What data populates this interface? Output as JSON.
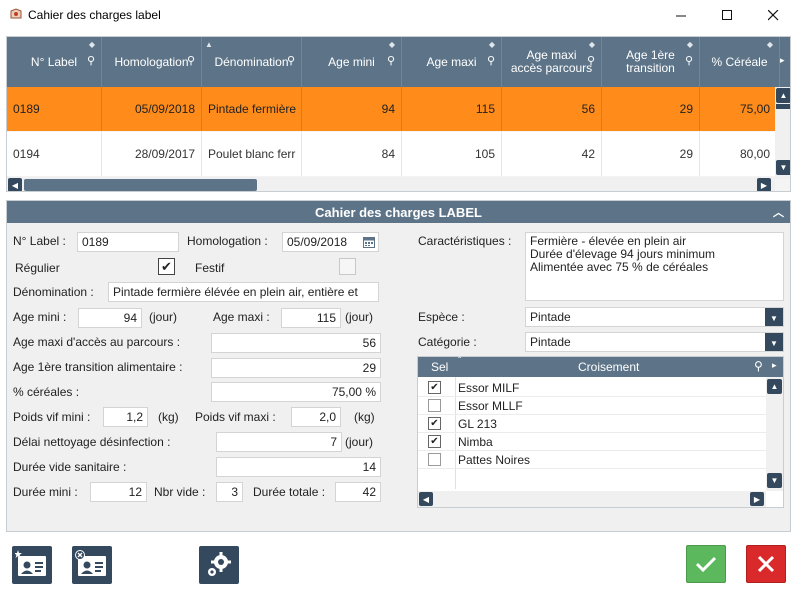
{
  "window": {
    "title": "Cahier des charges label"
  },
  "grid": {
    "columns": [
      "N° Label",
      "Homologation",
      "Dénomination",
      "Age mini",
      "Age maxi",
      "Age maxi\naccès parcours",
      "Age 1ère\ntransition",
      "% Céréale"
    ],
    "rows": [
      {
        "label": "0189",
        "homologation": "05/09/2018",
        "denomination": "Pintade fermière",
        "age_mini": "94",
        "age_maxi": "115",
        "age_parcours": "56",
        "age_transition": "29",
        "cereales": "75,00"
      },
      {
        "label": "0194",
        "homologation": "28/09/2017",
        "denomination": "Poulet blanc ferr",
        "age_mini": "84",
        "age_maxi": "105",
        "age_parcours": "42",
        "age_transition": "29",
        "cereales": "80,00"
      }
    ]
  },
  "panel": {
    "title": "Cahier des charges LABEL",
    "labels": {
      "no_label": "N° Label :",
      "homologation": "Homologation :",
      "regulier": "Régulier",
      "festif": "Festif",
      "denomination": "Dénomination :",
      "age_mini": "Age mini :",
      "age_maxi": "Age maxi :",
      "jour": "(jour)",
      "kg": "(kg)",
      "age_parcours": "Age maxi d'accès au parcours :",
      "age_transition": "Age 1ère transition alimentaire :",
      "cereales": "% céréales :",
      "poids_mini": "Poids vif mini :",
      "poids_maxi": "Poids vif maxi :",
      "delai": "Délai nettoyage désinfection :",
      "duree_vide": "Durée vide sanitaire :",
      "duree_mini": "Durée mini :",
      "nbr_vide": "Nbr vide :",
      "duree_totale": "Durée totale :",
      "caracteristiques": "Caractéristiques :",
      "espece": "Espèce :",
      "categorie": "Catégorie :"
    },
    "values": {
      "no_label": "0189",
      "homologation": "05/09/2018",
      "regulier": true,
      "festif": false,
      "denomination": "Pintade fermière élévée en plein air, entière et",
      "age_mini": "94",
      "age_maxi": "115",
      "age_parcours": "56",
      "age_transition": "29",
      "cereales": "75,00 %",
      "poids_mini": "1,2",
      "poids_maxi": "2,0",
      "delai": "7",
      "duree_vide": "14",
      "duree_mini": "12",
      "nbr_vide": "3",
      "duree_totale": "42",
      "caracteristiques_line1": "Fermière - élevée en plein air",
      "caracteristiques_line2": "Durée d'élevage 94 jours minimum",
      "caracteristiques_line3": "Alimentée avec 75 % de céréales",
      "espece": "Pintade",
      "categorie": "Pintade"
    },
    "croisement": {
      "col_sel": "Sel",
      "col_name": "Croisement",
      "items": [
        {
          "name": "Essor MILF",
          "checked": true
        },
        {
          "name": "Essor MLLF",
          "checked": false
        },
        {
          "name": "GL 213",
          "checked": true
        },
        {
          "name": "Nimba",
          "checked": true
        },
        {
          "name": "Pattes Noires",
          "checked": false
        }
      ]
    }
  },
  "icons": {
    "app": "app-icon",
    "search": "search-icon",
    "calendar": "calendar-icon",
    "new_card": "add-card-icon",
    "delete_card": "delete-card-icon",
    "settings": "gear-icon",
    "ok": "checkmark-icon",
    "cancel": "close-icon"
  },
  "colors": {
    "header": "#5d7488",
    "selected_row": "#ff8c1a",
    "ok": "#5cb85c",
    "cancel": "#d9292b"
  }
}
